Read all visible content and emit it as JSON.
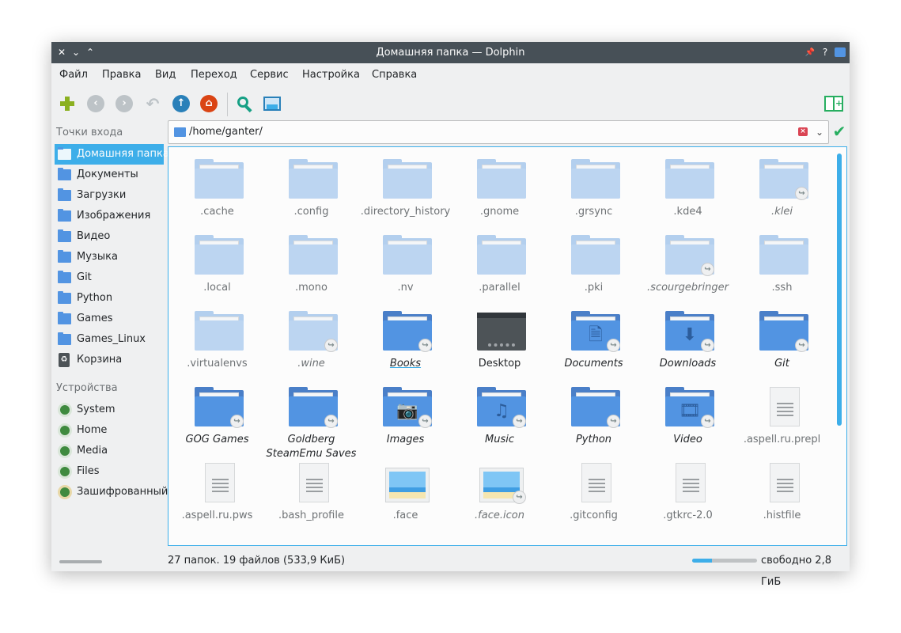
{
  "window": {
    "title": "Домашняя папка — Dolphin",
    "left_controls": [
      "✕",
      "⌄",
      "⌃"
    ],
    "right_controls": [
      "📌",
      "?"
    ]
  },
  "menu": [
    "Файл",
    "Правка",
    "Вид",
    "Переход",
    "Сервис",
    "Настройка",
    "Справка"
  ],
  "toolbar": {
    "icons": [
      "new-icon",
      "back-icon",
      "forward-icon",
      "undo-icon",
      "up-icon",
      "home-icon",
      "search-icon",
      "preview-icon",
      "split-view-icon"
    ],
    "colors": {
      "new": "#8bb020",
      "nav_disabled": "#bdc3c7",
      "up": "#2980b9",
      "home": "#da4414",
      "search": "#16a085"
    }
  },
  "places": {
    "entry_title": "Точки входа",
    "entries": [
      {
        "label": "Домашняя папка",
        "icon": "home-folder-icon",
        "active": true
      },
      {
        "label": "Документы",
        "icon": "documents-folder-icon"
      },
      {
        "label": "Загрузки",
        "icon": "downloads-folder-icon"
      },
      {
        "label": "Изображения",
        "icon": "pictures-folder-icon"
      },
      {
        "label": "Видео",
        "icon": "video-folder-icon"
      },
      {
        "label": "Музыка",
        "icon": "music-folder-icon"
      },
      {
        "label": "Git",
        "icon": "folder-icon"
      },
      {
        "label": "Python",
        "icon": "folder-icon"
      },
      {
        "label": "Games",
        "icon": "folder-icon"
      },
      {
        "label": "Games_Linux",
        "icon": "folder-icon"
      },
      {
        "label": "Корзина",
        "icon": "trash-icon"
      }
    ],
    "devices_title": "Устройства",
    "devices": [
      {
        "label": "System",
        "icon": "drive-icon"
      },
      {
        "label": "Home",
        "icon": "drive-icon"
      },
      {
        "label": "Media",
        "icon": "drive-icon"
      },
      {
        "label": "Files",
        "icon": "drive-icon"
      },
      {
        "label": "Зашифрованный",
        "icon": "encrypted-drive-icon"
      }
    ]
  },
  "address": {
    "path": "/home/ganter/"
  },
  "files": [
    {
      "name": ".cache",
      "type": "folder-light"
    },
    {
      "name": ".config",
      "type": "folder-light"
    },
    {
      "name": ".directory_history",
      "type": "folder-light"
    },
    {
      "name": ".gnome",
      "type": "folder-light"
    },
    {
      "name": ".grsync",
      "type": "folder-light"
    },
    {
      "name": ".kde4",
      "type": "folder-light"
    },
    {
      "name": ".klei",
      "type": "folder-light",
      "link": true
    },
    {
      "name": ".local",
      "type": "folder-light"
    },
    {
      "name": ".mono",
      "type": "folder-light"
    },
    {
      "name": ".nv",
      "type": "folder-light"
    },
    {
      "name": ".parallel",
      "type": "folder-light"
    },
    {
      "name": ".pki",
      "type": "folder-light"
    },
    {
      "name": ".scourgebringer",
      "type": "folder-light",
      "link": true
    },
    {
      "name": ".ssh",
      "type": "folder-light"
    },
    {
      "name": ".virtualenvs",
      "type": "folder-light"
    },
    {
      "name": ".wine",
      "type": "folder-light",
      "link": true
    },
    {
      "name": "Books",
      "type": "folder",
      "link": true,
      "focus": true
    },
    {
      "name": "Desktop",
      "type": "desktop"
    },
    {
      "name": "Documents",
      "type": "folder",
      "link": true,
      "glyph": "🗎"
    },
    {
      "name": "Downloads",
      "type": "folder",
      "link": true,
      "glyph": "⬇"
    },
    {
      "name": "Git",
      "type": "folder",
      "link": true
    },
    {
      "name": "GOG Games",
      "type": "folder",
      "link": true
    },
    {
      "name": "Goldberg SteamEmu Saves",
      "type": "folder",
      "link": true
    },
    {
      "name": "Images",
      "type": "folder",
      "link": true,
      "glyph": "📷"
    },
    {
      "name": "Music",
      "type": "folder",
      "link": true,
      "glyph": "♫"
    },
    {
      "name": "Python",
      "type": "folder",
      "link": true
    },
    {
      "name": "Video",
      "type": "folder",
      "link": true,
      "glyph": "🎞"
    },
    {
      "name": ".aspell.ru.prepl",
      "type": "doc"
    },
    {
      "name": ".aspell.ru.pws",
      "type": "doc"
    },
    {
      "name": ".bash_profile",
      "type": "doc"
    },
    {
      "name": ".face",
      "type": "image"
    },
    {
      "name": ".face.icon",
      "type": "image",
      "link": true
    },
    {
      "name": ".gitconfig",
      "type": "doc"
    },
    {
      "name": ".gtkrc-2.0",
      "type": "doc"
    },
    {
      "name": ".histfile",
      "type": "doc"
    }
  ],
  "status": {
    "summary": "27 папок. 19 файлов (533,9 КиБ)",
    "free_space": "свободно 2,8 ГиБ",
    "used_fraction": 0.3
  }
}
